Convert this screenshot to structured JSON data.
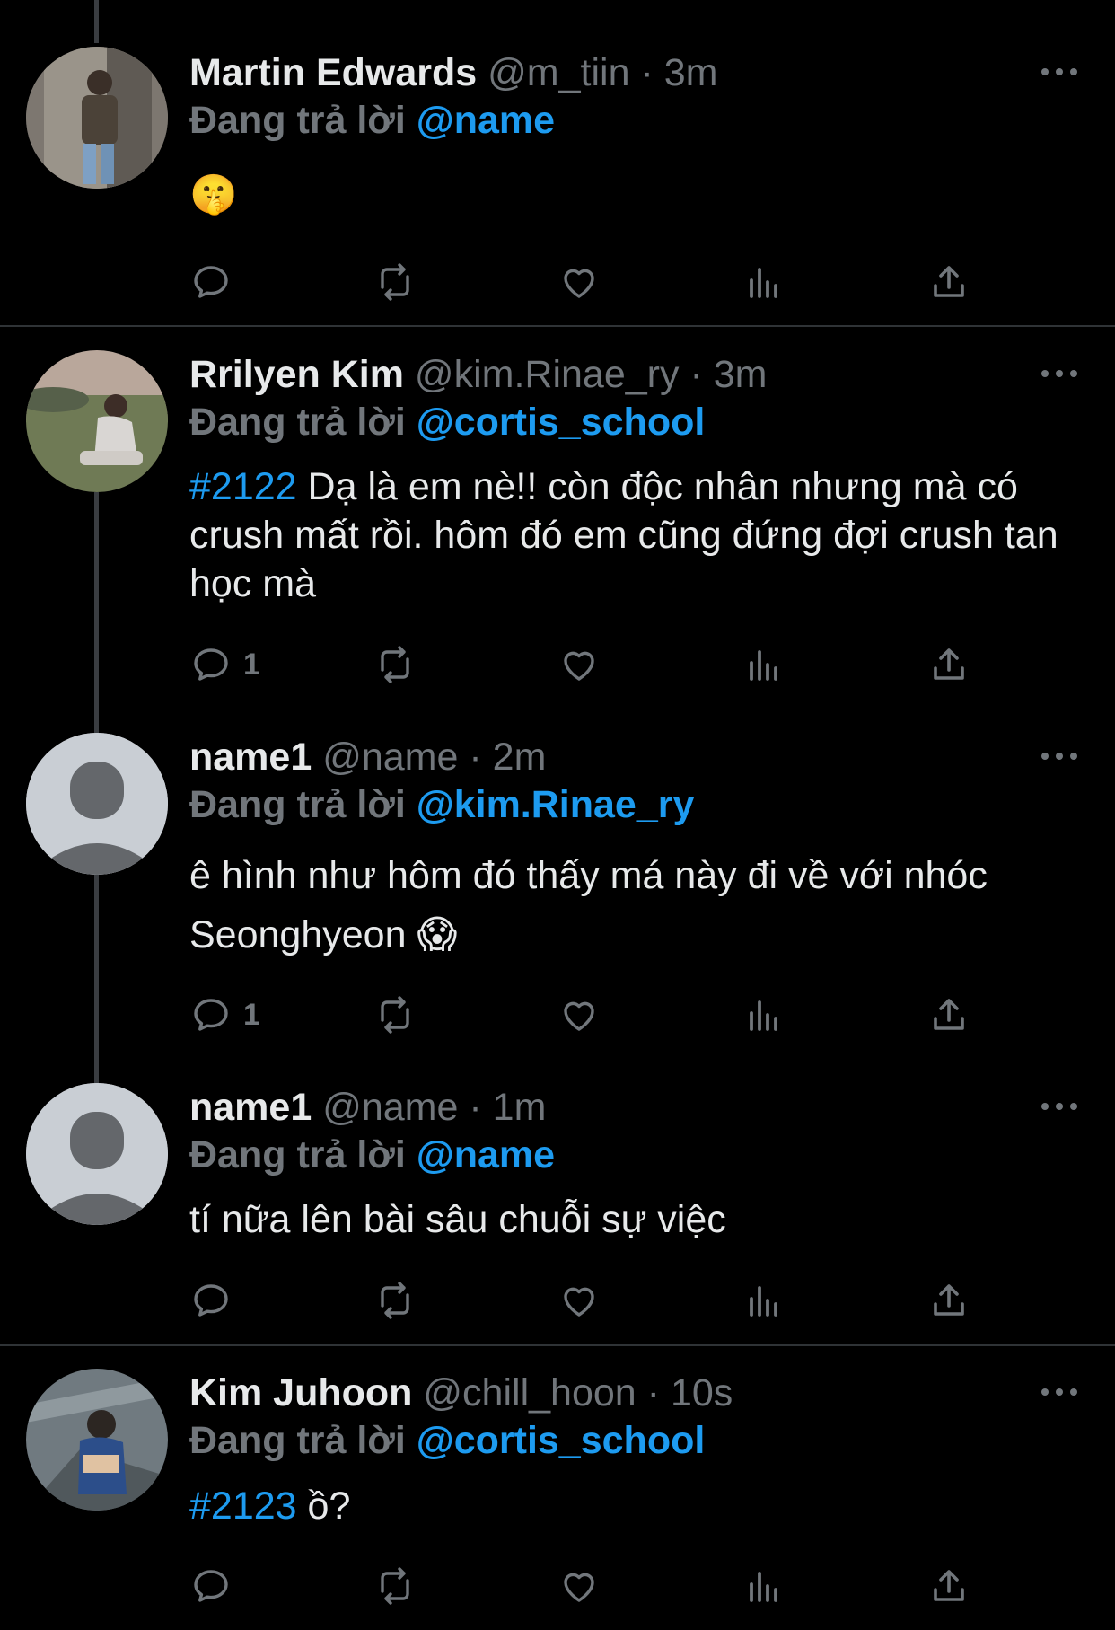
{
  "reply_prefix": "Đang trả lời",
  "tweets": [
    {
      "display_name": "Martin Edwards",
      "handle": "@m_tiin",
      "time": "3m",
      "reply_to": "@name",
      "hashtag": "",
      "text": "",
      "emoji": "🤫",
      "reply_count": "",
      "avatar": "photo-avatar"
    },
    {
      "display_name": "Rrilyen Kim",
      "handle": "@kim.Rinae_ry",
      "time": "3m",
      "reply_to": "@cortis_school",
      "hashtag": "#2122",
      "text": "Dạ là em nè!! còn độc nhân nhưng mà có crush mất rồi. hôm đó em cũng đứng đợi crush tan học mà",
      "emoji": "",
      "reply_count": "1",
      "avatar": "photo-avatar"
    },
    {
      "display_name": "name1",
      "handle": "@name",
      "time": "2m",
      "reply_to": "@kim.Rinae_ry",
      "hashtag": "",
      "text": "ê hình như hôm đó thấy má này đi về với nhóc Seonghyeon",
      "emoji": "😱",
      "reply_count": "1",
      "avatar": "default-avatar"
    },
    {
      "display_name": "name1",
      "handle": "@name",
      "time": "1m",
      "reply_to": "@name",
      "hashtag": "",
      "text": "tí nữa lên bài sâu chuỗi sự việc",
      "emoji": "",
      "reply_count": "",
      "avatar": "default-avatar"
    },
    {
      "display_name": "Kim Juhoon",
      "handle": "@chill_hoon",
      "time": "10s",
      "reply_to": "@cortis_school",
      "hashtag": "#2123",
      "text": "ồ?",
      "emoji": "",
      "reply_count": "",
      "avatar": "photo-avatar"
    }
  ],
  "colors": {
    "background": "#000000",
    "text": "#e7e9ea",
    "muted": "#71767b",
    "accent": "#1d9bf0",
    "divider": "#2f3336"
  }
}
